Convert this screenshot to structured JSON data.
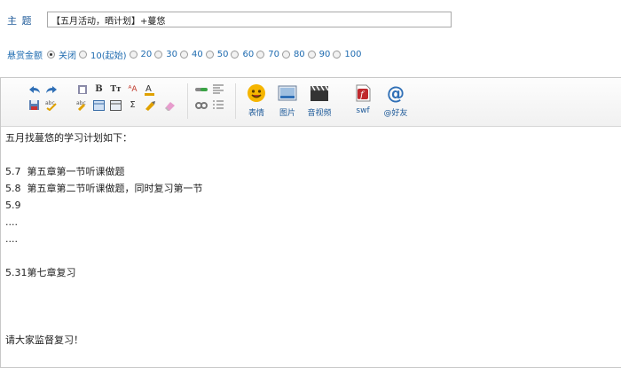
{
  "subject": {
    "label": "主 题",
    "value": "【五月活动，晒计划】+蔓悠"
  },
  "bounty": {
    "label": "悬赏金额",
    "options": [
      "关闭",
      "10(起始)",
      "20",
      "30",
      "40",
      "50",
      "60",
      "70",
      "80",
      "90",
      "100"
    ],
    "selected": "关闭"
  },
  "toolbar": {
    "small_icons": [
      "undo-icon",
      "redo-icon",
      "paste-icon",
      "bold-icon",
      "font-size-icon",
      "font-color-icon",
      "save-icon",
      "spellcheck-icon",
      "format-painter-icon",
      "table-icon",
      "table-alt-icon",
      "formula-icon",
      "highlighter-icon",
      "eraser-icon",
      "link-icon",
      "align-icon",
      "unlink-icon",
      "list-icon"
    ],
    "emoji_label": "表情",
    "image_label": "图片",
    "video_label": "音视频",
    "swf_label": "swf",
    "at_label": "@好友"
  },
  "content_lines": [
    "五月找蔓悠的学习计划如下：",
    "",
    "5.7  第五章第一节听课做题",
    "5.8  第五章第二节听课做题，同时复习第一节",
    "5.9",
    "....",
    "....",
    "",
    "5.31第七章复习",
    "",
    "",
    "",
    "请大家监督复习！"
  ],
  "colors": {
    "link_blue": "#1e6bb0",
    "border": "#c8c8c8"
  }
}
